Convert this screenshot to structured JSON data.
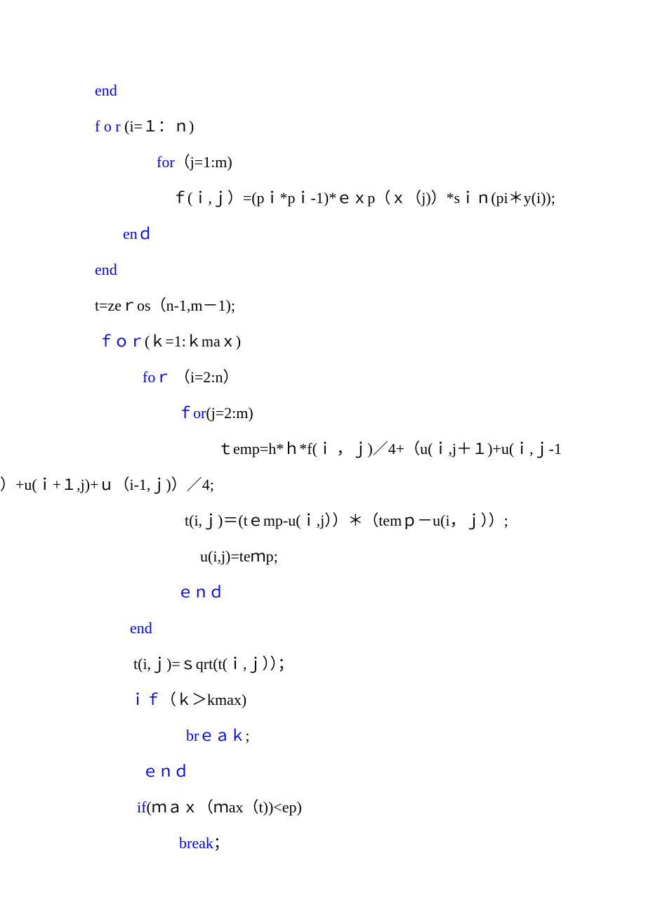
{
  "lines": {
    "l1_kw": "end",
    "l2_kw": "f o r",
    "l2_txt": " (i=１：ｎ)",
    "l3_kw": "for",
    "l3_txt": "（j=1:m)",
    "l4_txt": "ｆ(ｉ,ｊ）=(pｉ*pｉ-1)*ｅｘp（ｘ（j)）*sｉｎ(pi＊y(i));",
    "l5_kw": "enｄ",
    "l6_kw": "end",
    "l7_txt": "t=zeｒos（n-1,m－1);",
    "l8_kw": "ｆｏｒ",
    "l8_txt": "(ｋ=1:ｋmaｘ)",
    "l9_kw": "foｒ",
    "l9_txt": " （i=2:n）",
    "l10_kw": "ｆor",
    "l10_txt": "(j=2:m)",
    "l11_txt": "ｔemp=h*ｈ*f(ｉ ，ｊ)／4+（u(ｉ,j＋１)+u(ｉ,ｊ-1",
    "l12_txt": "）+u(ｉ+１,j)+ｕ（i-1,ｊ)）／4;",
    "l13_txt": "t(i,ｊ)＝(tｅmp-u(ｉ,j））＊（temｐ－u(i，ｊ））;",
    "l14_txt": "u(i,j)=teｍp;",
    "l15_kw": "ｅｎｄ",
    "l16_kw": "end",
    "l17_txt": "t(i,ｊ)=ｓqrt(t(ｉ,ｊ））；",
    "l18_kw": "ｉｆ",
    "l18_txt": "（ｋ＞kmax)",
    "l19_kw": "brｅａｋ",
    "l19_txt": ";",
    "l20_kw": "ｅｎｄ",
    "l21_kw": "if",
    "l21_txt": "(ｍａｘ（ｍax（t))<ep)",
    "l22_kw": "break",
    "l22_txt": "；"
  }
}
